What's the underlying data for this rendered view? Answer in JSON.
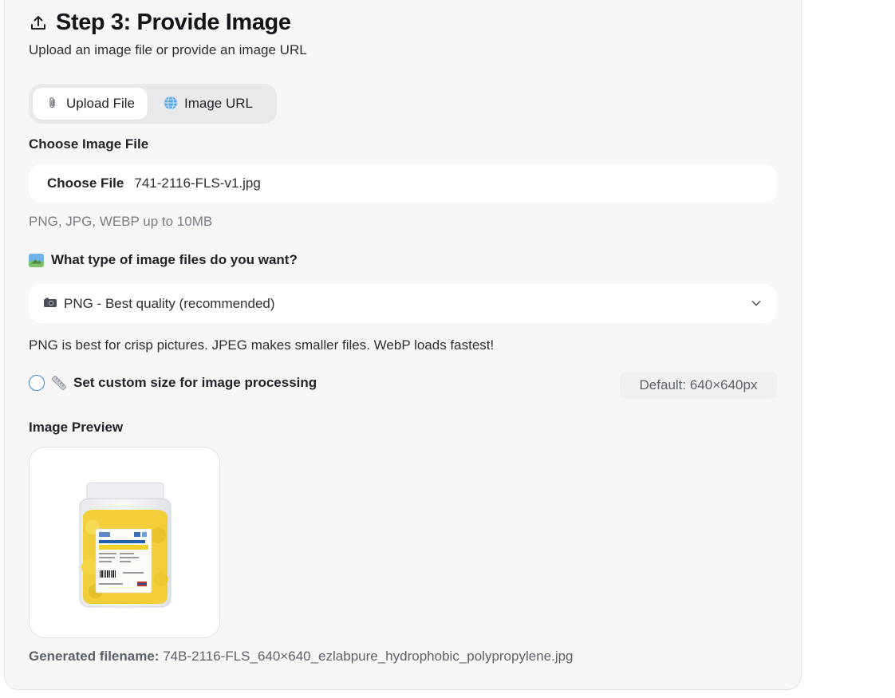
{
  "step": {
    "title": "Step 3: Provide Image",
    "subtitle": "Upload an image file or provide an image URL"
  },
  "source_tabs": [
    {
      "label": "Upload File",
      "icon": "paperclip-icon",
      "active": true
    },
    {
      "label": "Image URL",
      "icon": "globe-icon",
      "active": false
    }
  ],
  "file_input": {
    "label": "Choose Image File",
    "button_label": "Choose File",
    "selected_file": "741-2116-FLS-v1.jpg",
    "hint": "PNG, JPG, WEBP up to 10MB"
  },
  "format": {
    "question": "What type of image files do you want?",
    "question_icon": "picture-icon",
    "selected": "PNG - Best quality (recommended)",
    "selected_icon": "camera-icon",
    "note": "PNG is best for crisp pictures. JPEG makes smaller files. WebP loads fastest!"
  },
  "custom_size": {
    "label": "Set custom size for image processing",
    "icon": "ruler-icon",
    "checked": false,
    "default_text": "Default: 640×640px"
  },
  "preview": {
    "label": "Image Preview"
  },
  "generated": {
    "label": "Generated filename:",
    "value": "74B-2116-FLS_640×640_ezlabpure_hydrophobic_polypropylene.jpg"
  },
  "colors": {
    "accent": "#3a8bd8",
    "card_bg": "#f7f7f8",
    "muted_text": "#7a7f86"
  }
}
